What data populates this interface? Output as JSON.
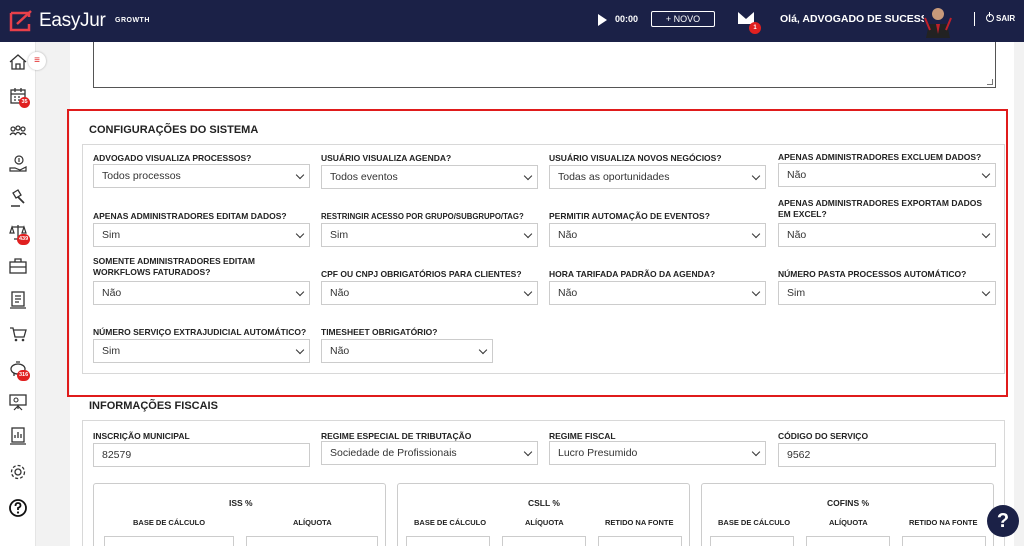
{
  "header": {
    "logo_text": "EasyJur",
    "logo_sub": "GROWTH",
    "timer": "00:00",
    "novo_label": "+ NOVO",
    "mail_badge": "1",
    "greeting": "Olá, ADVOGADO DE SUCESSO",
    "sair_label": "SAIR"
  },
  "sidebar": {
    "items": [
      {
        "icon": "home-icon"
      },
      {
        "icon": "calendar-icon",
        "badge": "35"
      },
      {
        "icon": "people-icon"
      },
      {
        "icon": "money-hand-icon"
      },
      {
        "icon": "gavel-icon"
      },
      {
        "icon": "scales-icon",
        "badge": "439"
      },
      {
        "icon": "briefcase-icon"
      },
      {
        "icon": "document-icon"
      },
      {
        "icon": "cart-icon"
      },
      {
        "icon": "piggy-bank-icon",
        "badge": "316"
      },
      {
        "icon": "presentation-icon"
      },
      {
        "icon": "report-icon"
      },
      {
        "icon": "gear-icon"
      },
      {
        "icon": "help-circle-icon"
      }
    ],
    "menu_toggle": "≡"
  },
  "config": {
    "title": "CONFIGURAÇÕES DO SISTEMA",
    "fields": [
      {
        "label": "ADVOGADO VISUALIZA PROCESSOS?",
        "value": "Todos processos"
      },
      {
        "label": "USUÁRIO VISUALIZA AGENDA?",
        "value": "Todos eventos"
      },
      {
        "label": "USUÁRIO VISUALIZA NOVOS NEGÓCIOS?",
        "value": "Todas as oportunidades"
      },
      {
        "label": "APENAS ADMINISTRADORES EXCLUEM DADOS?",
        "value": "Não"
      },
      {
        "label": "APENAS ADMINISTRADORES EDITAM DADOS?",
        "value": "Sim"
      },
      {
        "label": "RESTRINGIR ACESSO POR GRUPO/SUBGRUPO/TAG?",
        "value": "Sim"
      },
      {
        "label": "PERMITIR AUTOMAÇÃO DE EVENTOS?",
        "value": "Não"
      },
      {
        "label": "APENAS ADMINISTRADORES EXPORTAM DADOS EM EXCEL?",
        "value": "Não"
      },
      {
        "label": "SOMENTE ADMINISTRADORES EDITAM WORKFLOWS FATURADOS?",
        "value": "Não"
      },
      {
        "label": "CPF OU CNPJ OBRIGATÓRIOS PARA CLIENTES?",
        "value": "Não"
      },
      {
        "label": "HORA TARIFADA PADRÃO DA AGENDA?",
        "value": "Não"
      },
      {
        "label": "NÚMERO PASTA PROCESSOS AUTOMÁTICO?",
        "value": "Sim"
      },
      {
        "label": "NÚMERO SERVIÇO EXTRAJUDICIAL AUTOMÁTICO?",
        "value": "Sim"
      },
      {
        "label": "TIMESHEET OBRIGATÓRIO?",
        "value": "Não"
      }
    ]
  },
  "fiscal": {
    "title": "INFORMAÇÕES FISCAIS",
    "inscricao_label": "INSCRIÇÃO MUNICIPAL",
    "inscricao_value": "82579",
    "regime_especial_label": "REGIME ESPECIAL DE TRIBUTAÇÃO",
    "regime_especial_value": "Sociedade de Profissionais",
    "regime_fiscal_label": "REGIME FISCAL",
    "regime_fiscal_value": "Lucro Presumido",
    "codigo_label": "CÓDIGO DO SERVIÇO",
    "codigo_value": "9562",
    "taxes": [
      {
        "title": "ISS %",
        "cols": [
          "BASE DE CÁLCULO",
          "ALÍQUOTA"
        ]
      },
      {
        "title": "CSLL %",
        "cols": [
          "BASE DE CÁLCULO",
          "ALÍQUOTA",
          "RETIDO NA FONTE"
        ]
      },
      {
        "title": "COFINS %",
        "cols": [
          "BASE DE CÁLCULO",
          "ALÍQUOTA",
          "RETIDO NA FONTE"
        ]
      }
    ]
  },
  "help_label": "?"
}
